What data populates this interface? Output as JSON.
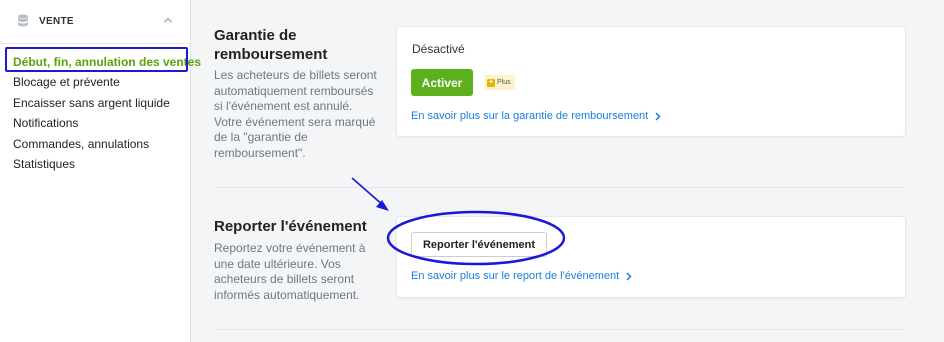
{
  "sidebar": {
    "section_title": "VENTE",
    "items": [
      {
        "label": "Début, fin, annulation des ventes",
        "active": true
      },
      {
        "label": "Blocage et prévente",
        "active": false
      },
      {
        "label": "Encaisser sans argent liquide",
        "active": false
      },
      {
        "label": "Notifications",
        "active": false
      },
      {
        "label": "Commandes, annulations",
        "active": false
      },
      {
        "label": "Statistiques",
        "active": false
      }
    ]
  },
  "refund": {
    "title_line1": "Garantie de",
    "title_line2": "remboursement",
    "desc_lines": [
      "Les acheteurs de billets seront",
      "automatiquement remboursés",
      "si l'événement est annulé.",
      "Votre événement sera marqué",
      "de la \"garantie de",
      "remboursement\"."
    ],
    "status": "Désactivé",
    "activate_label": "Activer",
    "plus_label": "Plus",
    "link": "En savoir plus sur la garantie de remboursement"
  },
  "postpone": {
    "title": "Reporter l'événement",
    "desc_lines": [
      "Reportez votre événement à",
      "une date ultérieure. Vos",
      "acheteurs de billets seront",
      "informés automatiquement."
    ],
    "button_label": "Reporter l'événement",
    "link": "En savoir plus sur le report de l'événement"
  },
  "colors": {
    "accent_green": "#5cb01c",
    "link_blue": "#1a7fe0",
    "annotation_blue": "#1a1ad6"
  },
  "icons": {
    "section": "database-icon",
    "collapse": "chevron-up-icon",
    "link": "chevron-right-icon",
    "plus_badge": "plus-square-icon"
  }
}
